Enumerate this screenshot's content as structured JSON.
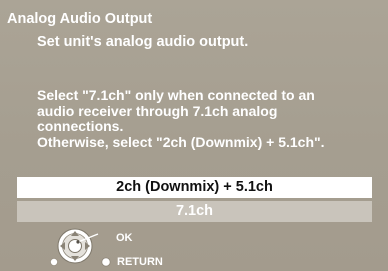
{
  "menu": {
    "title": "Analog Audio Output",
    "subtitle": "Set unit's analog audio output.",
    "instructions": [
      "Select \"7.1ch\" only when connected to an",
      "audio receiver through 7.1ch analog",
      "connections.",
      "Otherwise, select \"2ch (Downmix) + 5.1ch\"."
    ],
    "options": [
      {
        "label": "2ch (Downmix) + 5.1ch",
        "selected": true
      },
      {
        "label": "7.1ch",
        "selected": false
      }
    ]
  },
  "controls": {
    "ok_label": "OK",
    "return_label": "RETURN",
    "ok_icon": "remote-cursor-pad-icon",
    "return_icon": "return-button-icon"
  },
  "colors": {
    "background": "#a8a092",
    "text": "#ffffff",
    "selected_bg": "#ffffff",
    "selected_text": "#111111",
    "unselected_bg": "#c9c4bb"
  }
}
